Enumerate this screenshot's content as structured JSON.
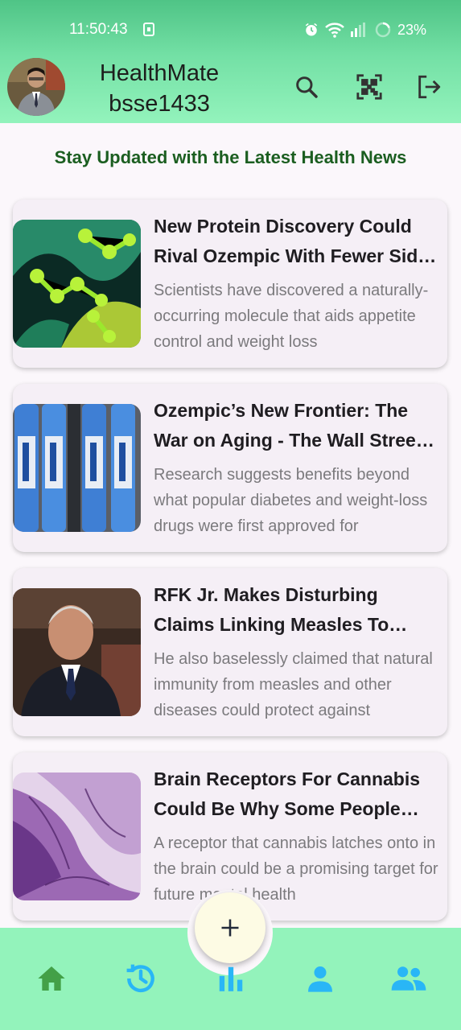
{
  "status_bar": {
    "time": "11:50:43",
    "battery": "23%"
  },
  "header": {
    "title_line1": "HealthMate",
    "title_line2": "bsse1433",
    "icons": [
      "search-icon",
      "qr-code-icon",
      "logout-icon"
    ]
  },
  "subtitle": "Stay Updated with the Latest Health News",
  "articles": [
    {
      "title": "New Protein Discovery Could Rival Ozempic With Fewer Side Effects",
      "description": "Scientists have discovered a naturally-occurring molecule that aids appetite control and weight loss",
      "image": "protein-molecule-image"
    },
    {
      "title": "Ozempic’s New Frontier: The War on Aging - The Wall Street Journal",
      "description": "Research suggests benefits beyond what popular diabetes and weight-loss drugs were first approved for",
      "image": "ozempic-pens-image"
    },
    {
      "title": "RFK Jr. Makes Disturbing Claims Linking Measles To Cancer",
      "description": "He also baselessly claimed that natural immunity from measles and other diseases could protect against",
      "image": "rfk-jr-photo"
    },
    {
      "title": "Brain Receptors For Cannabis Could Be Why Some People Overeat",
      "description": "A receptor that cannabis latches onto in the brain could be a promising target for future mental health",
      "image": "brain-tissue-image"
    }
  ],
  "fab": {
    "icon": "plus-icon"
  },
  "bottom_nav": {
    "items": [
      "home-icon",
      "history-icon",
      "stats-icon",
      "profile-icon",
      "community-icon"
    ],
    "colors": {
      "home": "#43a047",
      "others": "#29b6f6"
    }
  }
}
